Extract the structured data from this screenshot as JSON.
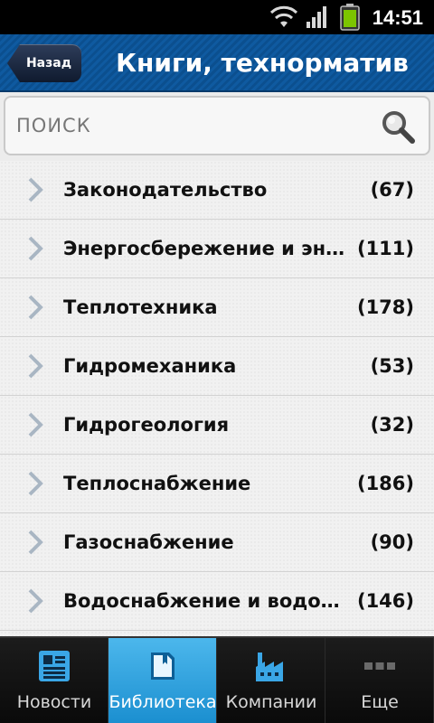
{
  "status_bar": {
    "time": "14:51",
    "icons": [
      "wifi-icon",
      "signal-icon",
      "battery-icon"
    ]
  },
  "header": {
    "back_label": "Назад",
    "title": "Книги, технорматив"
  },
  "search": {
    "placeholder": "ПОИСК",
    "icon": "search-icon"
  },
  "list": {
    "items": [
      {
        "label": "Законодательство",
        "count": "(67)"
      },
      {
        "label": "Энергосбережение и эн…",
        "count": "(111)"
      },
      {
        "label": "Теплотехника",
        "count": "(178)"
      },
      {
        "label": "Гидромеханика",
        "count": "(53)"
      },
      {
        "label": "Гидрогеология",
        "count": "(32)"
      },
      {
        "label": "Теплоснабжение",
        "count": "(186)"
      },
      {
        "label": "Газоснабжение",
        "count": "(90)"
      },
      {
        "label": "Водоснабжение и водоо…",
        "count": "(146)"
      }
    ]
  },
  "tabbar": {
    "active_index": 1,
    "tabs": [
      {
        "label": "Новости",
        "icon": "news-icon"
      },
      {
        "label": "Библиотека",
        "icon": "library-icon"
      },
      {
        "label": "Компании",
        "icon": "factory-icon"
      },
      {
        "label": "Еще",
        "icon": "more-icon"
      }
    ]
  },
  "colors": {
    "header_blue": "#0f5aa0",
    "active_tab_blue": "#2aa0e0",
    "battery_green": "#7cc400"
  }
}
